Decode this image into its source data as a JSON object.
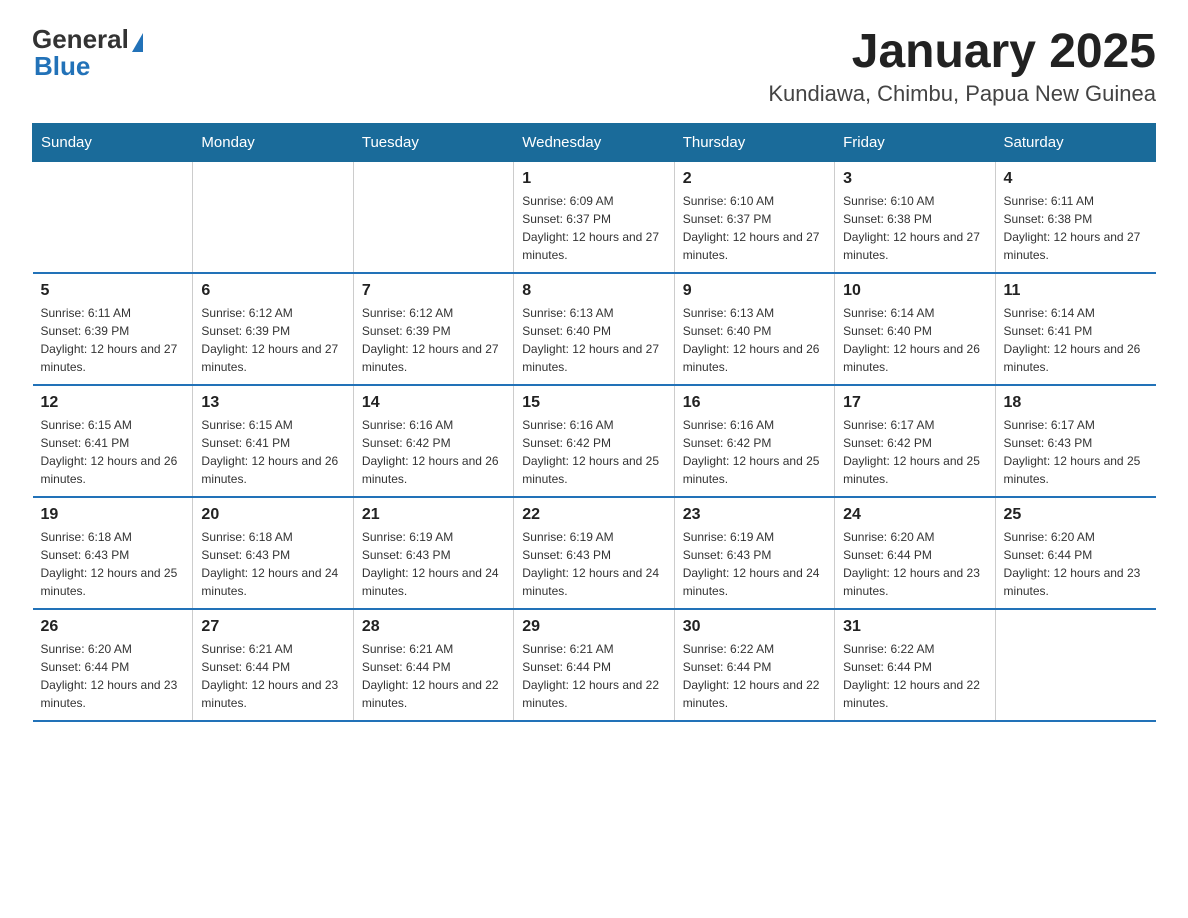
{
  "logo": {
    "general": "General",
    "blue": "Blue"
  },
  "title": "January 2025",
  "subtitle": "Kundiawa, Chimbu, Papua New Guinea",
  "days_of_week": [
    "Sunday",
    "Monday",
    "Tuesday",
    "Wednesday",
    "Thursday",
    "Friday",
    "Saturday"
  ],
  "weeks": [
    [
      {
        "day": "",
        "info": ""
      },
      {
        "day": "",
        "info": ""
      },
      {
        "day": "",
        "info": ""
      },
      {
        "day": "1",
        "info": "Sunrise: 6:09 AM\nSunset: 6:37 PM\nDaylight: 12 hours and 27 minutes."
      },
      {
        "day": "2",
        "info": "Sunrise: 6:10 AM\nSunset: 6:37 PM\nDaylight: 12 hours and 27 minutes."
      },
      {
        "day": "3",
        "info": "Sunrise: 6:10 AM\nSunset: 6:38 PM\nDaylight: 12 hours and 27 minutes."
      },
      {
        "day": "4",
        "info": "Sunrise: 6:11 AM\nSunset: 6:38 PM\nDaylight: 12 hours and 27 minutes."
      }
    ],
    [
      {
        "day": "5",
        "info": "Sunrise: 6:11 AM\nSunset: 6:39 PM\nDaylight: 12 hours and 27 minutes."
      },
      {
        "day": "6",
        "info": "Sunrise: 6:12 AM\nSunset: 6:39 PM\nDaylight: 12 hours and 27 minutes."
      },
      {
        "day": "7",
        "info": "Sunrise: 6:12 AM\nSunset: 6:39 PM\nDaylight: 12 hours and 27 minutes."
      },
      {
        "day": "8",
        "info": "Sunrise: 6:13 AM\nSunset: 6:40 PM\nDaylight: 12 hours and 27 minutes."
      },
      {
        "day": "9",
        "info": "Sunrise: 6:13 AM\nSunset: 6:40 PM\nDaylight: 12 hours and 26 minutes."
      },
      {
        "day": "10",
        "info": "Sunrise: 6:14 AM\nSunset: 6:40 PM\nDaylight: 12 hours and 26 minutes."
      },
      {
        "day": "11",
        "info": "Sunrise: 6:14 AM\nSunset: 6:41 PM\nDaylight: 12 hours and 26 minutes."
      }
    ],
    [
      {
        "day": "12",
        "info": "Sunrise: 6:15 AM\nSunset: 6:41 PM\nDaylight: 12 hours and 26 minutes."
      },
      {
        "day": "13",
        "info": "Sunrise: 6:15 AM\nSunset: 6:41 PM\nDaylight: 12 hours and 26 minutes."
      },
      {
        "day": "14",
        "info": "Sunrise: 6:16 AM\nSunset: 6:42 PM\nDaylight: 12 hours and 26 minutes."
      },
      {
        "day": "15",
        "info": "Sunrise: 6:16 AM\nSunset: 6:42 PM\nDaylight: 12 hours and 25 minutes."
      },
      {
        "day": "16",
        "info": "Sunrise: 6:16 AM\nSunset: 6:42 PM\nDaylight: 12 hours and 25 minutes."
      },
      {
        "day": "17",
        "info": "Sunrise: 6:17 AM\nSunset: 6:42 PM\nDaylight: 12 hours and 25 minutes."
      },
      {
        "day": "18",
        "info": "Sunrise: 6:17 AM\nSunset: 6:43 PM\nDaylight: 12 hours and 25 minutes."
      }
    ],
    [
      {
        "day": "19",
        "info": "Sunrise: 6:18 AM\nSunset: 6:43 PM\nDaylight: 12 hours and 25 minutes."
      },
      {
        "day": "20",
        "info": "Sunrise: 6:18 AM\nSunset: 6:43 PM\nDaylight: 12 hours and 24 minutes."
      },
      {
        "day": "21",
        "info": "Sunrise: 6:19 AM\nSunset: 6:43 PM\nDaylight: 12 hours and 24 minutes."
      },
      {
        "day": "22",
        "info": "Sunrise: 6:19 AM\nSunset: 6:43 PM\nDaylight: 12 hours and 24 minutes."
      },
      {
        "day": "23",
        "info": "Sunrise: 6:19 AM\nSunset: 6:43 PM\nDaylight: 12 hours and 24 minutes."
      },
      {
        "day": "24",
        "info": "Sunrise: 6:20 AM\nSunset: 6:44 PM\nDaylight: 12 hours and 23 minutes."
      },
      {
        "day": "25",
        "info": "Sunrise: 6:20 AM\nSunset: 6:44 PM\nDaylight: 12 hours and 23 minutes."
      }
    ],
    [
      {
        "day": "26",
        "info": "Sunrise: 6:20 AM\nSunset: 6:44 PM\nDaylight: 12 hours and 23 minutes."
      },
      {
        "day": "27",
        "info": "Sunrise: 6:21 AM\nSunset: 6:44 PM\nDaylight: 12 hours and 23 minutes."
      },
      {
        "day": "28",
        "info": "Sunrise: 6:21 AM\nSunset: 6:44 PM\nDaylight: 12 hours and 22 minutes."
      },
      {
        "day": "29",
        "info": "Sunrise: 6:21 AM\nSunset: 6:44 PM\nDaylight: 12 hours and 22 minutes."
      },
      {
        "day": "30",
        "info": "Sunrise: 6:22 AM\nSunset: 6:44 PM\nDaylight: 12 hours and 22 minutes."
      },
      {
        "day": "31",
        "info": "Sunrise: 6:22 AM\nSunset: 6:44 PM\nDaylight: 12 hours and 22 minutes."
      },
      {
        "day": "",
        "info": ""
      }
    ]
  ]
}
